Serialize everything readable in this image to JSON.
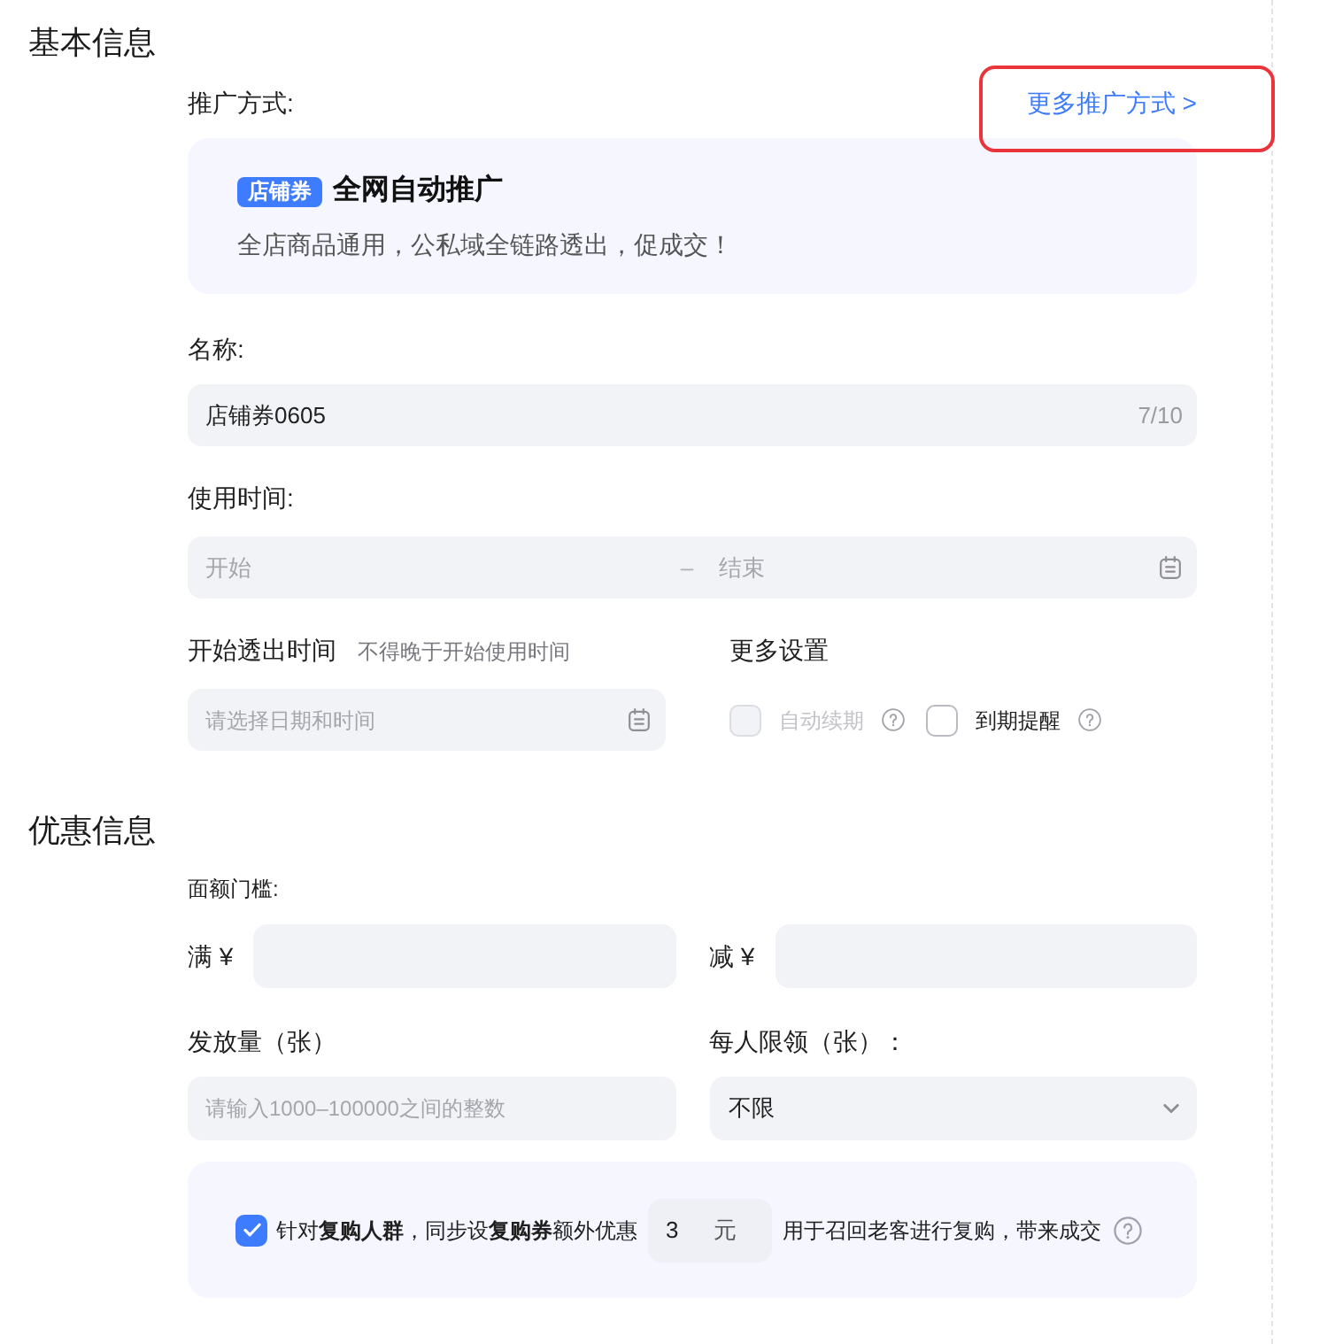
{
  "basic_info": {
    "title": "基本信息",
    "promotion": {
      "label": "推广方式:",
      "more_link": {
        "text": "更多推广方式 >",
        "highlighted": true
      },
      "card": {
        "badge": "店铺券",
        "title": "全网自动推广",
        "description": "全店商品通用，公私域全链路透出，促成交！"
      }
    },
    "name": {
      "label": "名称:",
      "value": "店铺券0605",
      "counter": "7/10"
    },
    "usage_time": {
      "label": "使用时间:",
      "start_placeholder": "开始",
      "separator": "–",
      "end_placeholder": "结束"
    },
    "exposure_time": {
      "label": "开始透出时间",
      "hint": "不得晚于开始使用时间",
      "placeholder": "请选择日期和时间"
    },
    "more_settings": {
      "title": "更多设置",
      "options": [
        {
          "label": "自动续期",
          "checked": false,
          "disabled": true
        },
        {
          "label": "到期提醒",
          "checked": false,
          "disabled": false
        }
      ]
    }
  },
  "discount_info": {
    "title": "优惠信息",
    "threshold": {
      "label": "面额门槛:",
      "fields": [
        {
          "prefix": "满 ¥"
        },
        {
          "prefix": "减 ¥"
        }
      ]
    },
    "quantity": {
      "label": "发放量（张）",
      "placeholder": "请输入1000–100000之间的整数"
    },
    "per_person_limit": {
      "label": "每人限领（张）：",
      "value": "不限"
    },
    "repurchase": {
      "checked": true,
      "text": "针对**复购人群**，同步设**复购券**额外优惠",
      "amount": "3",
      "unit": "元",
      "suffix_text": "用于召回老客进行复购，带来成交"
    }
  }
}
